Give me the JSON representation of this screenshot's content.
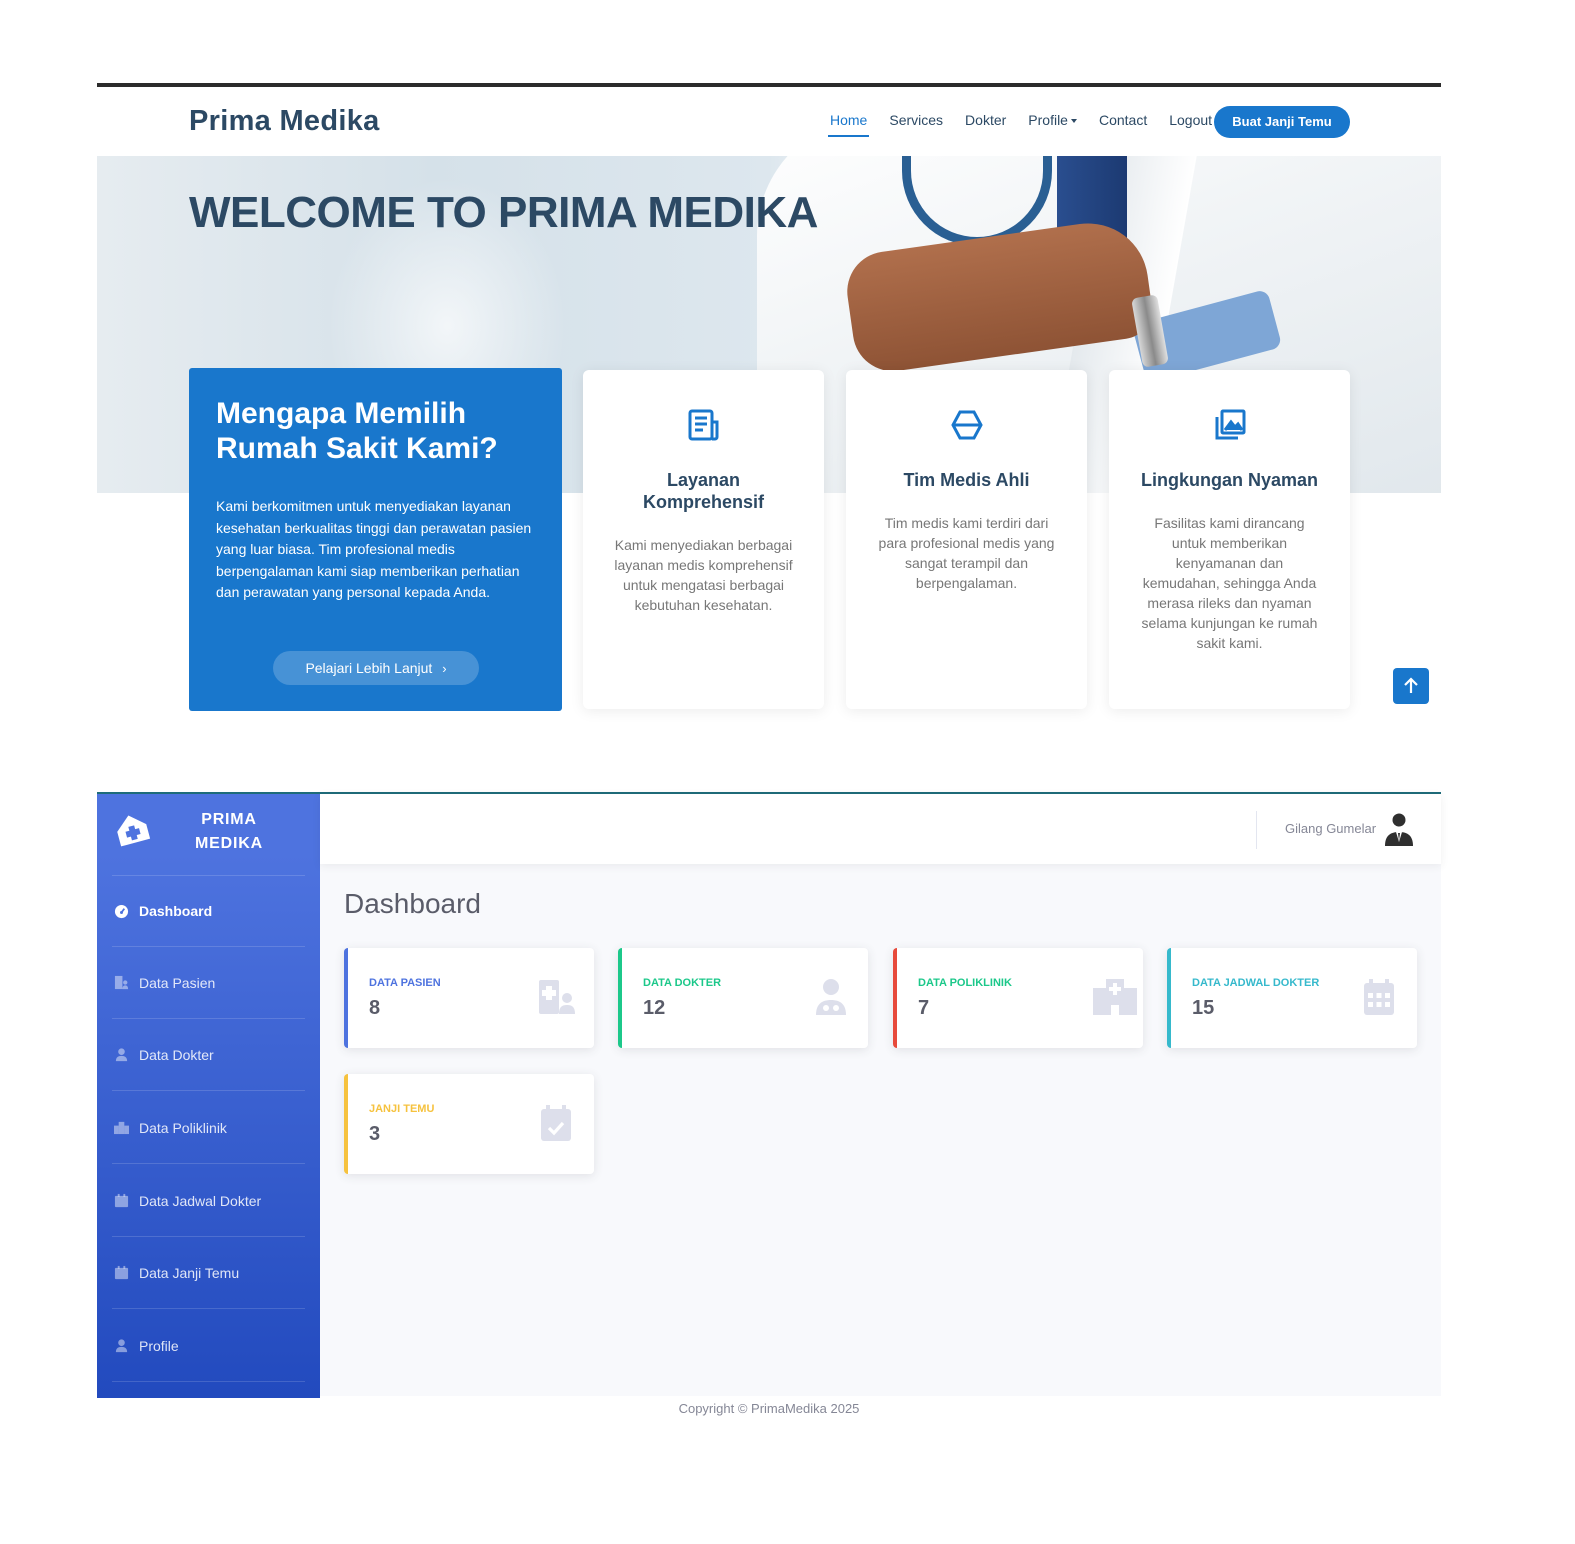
{
  "landing": {
    "brand": "Prima Medika",
    "nav": [
      {
        "label": "Home"
      },
      {
        "label": "Services"
      },
      {
        "label": "Dokter"
      },
      {
        "label": "Profile"
      },
      {
        "label": "Contact"
      },
      {
        "label": "Logout"
      }
    ],
    "cta_label": "Buat Janji Temu",
    "hero_title": "WELCOME TO PRIMA MEDIKA",
    "why": {
      "title": "Mengapa Memilih Rumah Sakit Kami?",
      "text": "Kami berkomitmen untuk menyediakan layanan kesehatan berkualitas tinggi dan perawatan pasien yang luar biasa. Tim profesional medis berpengalaman kami siap memberikan perhatian dan perawatan yang personal kepada Anda.",
      "button": "Pelajari Lebih Lanjut"
    },
    "features": [
      {
        "icon": "document-icon",
        "title": "Layanan Komprehensif",
        "text": "Kami menyediakan berbagai layanan medis komprehensif untuk mengatasi berbagai kebutuhan kesehatan."
      },
      {
        "icon": "hexagon-icon",
        "title": "Tim Medis Ahli",
        "text": "Tim medis kami terdiri dari para profesional medis yang sangat terampil dan berpengalaman."
      },
      {
        "icon": "images-icon",
        "title": "Lingkungan Nyaman",
        "text": "Fasilitas kami dirancang untuk memberikan kenyamanan dan kemudahan, sehingga Anda merasa rileks dan nyaman selama kunjungan ke rumah sakit kami."
      }
    ],
    "accent_color": "#1977cc"
  },
  "admin": {
    "brand": "PRIMA MEDIKA",
    "sidebar": [
      {
        "label": "Dashboard",
        "icon": "tachometer-icon",
        "active": true
      },
      {
        "label": "Data Pasien",
        "icon": "hospital-user-icon"
      },
      {
        "label": "Data Dokter",
        "icon": "user-icon"
      },
      {
        "label": "Data Poliklinik",
        "icon": "clinic-icon"
      },
      {
        "label": "Data Jadwal Dokter",
        "icon": "calendar-icon"
      },
      {
        "label": "Data Janji Temu",
        "icon": "calendar-check-icon"
      },
      {
        "label": "Profile",
        "icon": "user-icon"
      }
    ],
    "user_name": "Gilang Gumelar",
    "page_title": "Dashboard",
    "cards": [
      {
        "label": "DATA PASIEN",
        "value": "8",
        "color": "#4e73df",
        "icon": "hospital-user-icon"
      },
      {
        "label": "DATA DOKTER",
        "value": "12",
        "color": "#1cc88a",
        "icon": "user-doctor-icon"
      },
      {
        "label": "DATA POLIKLINIK",
        "value": "7",
        "color": "#e74a3b",
        "icon": "hospital-icon"
      },
      {
        "label": "DATA JADWAL DOKTER",
        "value": "15",
        "color": "#36b9cc",
        "icon": "calendar-icon"
      },
      {
        "label": "JANJI TEMU",
        "value": "3",
        "color": "#f6c23e",
        "icon": "calendar-check-icon"
      }
    ],
    "copyright": "Copyright © PrimaMedika 2025"
  }
}
